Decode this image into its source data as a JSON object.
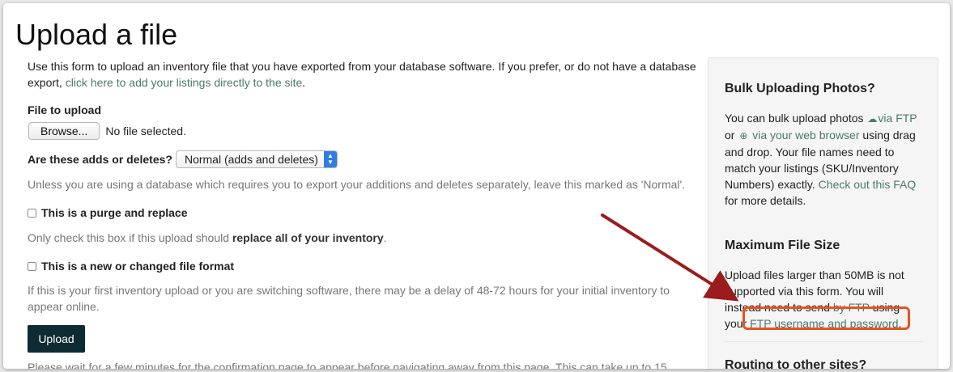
{
  "page": {
    "title": "Upload a file"
  },
  "intro": {
    "text": "Use this form to upload an inventory file that you have exported from your database software. If you prefer, or do not have a database export, ",
    "link": "click here to add your listings directly to the site",
    "end": "."
  },
  "file_upload": {
    "label": "File to upload",
    "browse_label": "Browse...",
    "status": "No file selected."
  },
  "adds_deletes": {
    "label": "Are these adds or deletes?",
    "selected": "Normal (adds and deletes)",
    "help": "Unless you are using a database which requires you to export your additions and deletes separately, leave this marked as 'Normal'."
  },
  "purge": {
    "label": "This is a purge and replace",
    "help_prefix": "Only check this box if this upload should ",
    "help_bold": "replace all of your inventory",
    "help_suffix": "."
  },
  "format": {
    "label": "This is a new or changed file format",
    "help": "If this is your first inventory upload or you are switching software, there may be a delay of 48-72 hours for your initial inventory to appear online."
  },
  "upload": {
    "button_label": "Upload",
    "wait_text": "Please wait for a few minutes for the confirmation page to appear before navigating away from this page. This can take up to 15"
  },
  "sidebar": {
    "bulk": {
      "title": "Bulk Uploading Photos?",
      "t1": "You can bulk upload photos ",
      "ftp_link": "via FTP",
      "t2": "or ",
      "browser_link": "via your web browser",
      "t3": " using drag and drop. Your file names need to match your listings (SKU/Inventory Numbers) exactly. ",
      "faq_link": "Check out this FAQ",
      "t4": " for more details."
    },
    "max": {
      "title": "Maximum File Size",
      "t1": "Upload files larger than 50MB is not supported via this form. You will instead need to send ",
      "ftp_link": "by FTP",
      "t2": " using your ",
      "cred_link": "FTP username and password",
      "t3": "."
    },
    "routing": {
      "title": "Routing to other sites?"
    }
  },
  "icons": {
    "cloud": "cloud-upload-icon",
    "upload_circle": "upload-circle-icon"
  },
  "colors": {
    "link": "#4a7a6a",
    "button": "#0e2a33",
    "highlight": "#e8521f",
    "arrow": "#9b1c1c"
  }
}
